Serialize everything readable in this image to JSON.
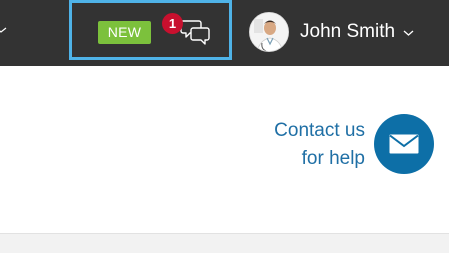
{
  "header": {
    "notifications": {
      "new_label": "NEW",
      "unread_count": "1"
    },
    "user": {
      "name": "John Smith"
    }
  },
  "help": {
    "line1": "Contact us",
    "line2": "for help"
  },
  "colors": {
    "topbar": "#333333",
    "highlight_border": "#4fb3e8",
    "new_badge": "#7cc13c",
    "count_badge": "#c8102e",
    "link": "#1f6fa5",
    "mail_button": "#0d6fa7"
  },
  "icons": {
    "left": "chevron-down-icon",
    "chat": "chat-bubbles-icon",
    "user_menu": "chevron-down-icon",
    "mail": "envelope-icon"
  }
}
